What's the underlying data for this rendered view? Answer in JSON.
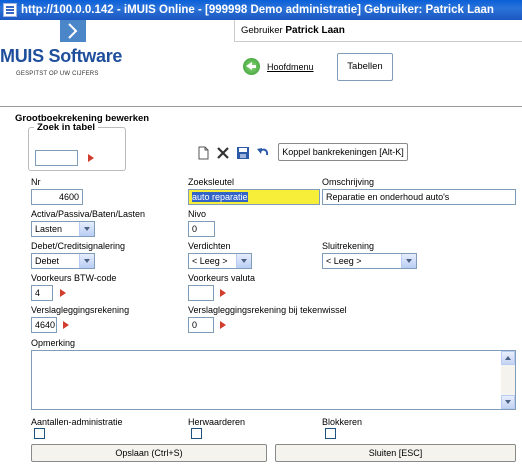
{
  "window": {
    "title": "http://100.0.0.142 - iMUIS Online - [999998 Demo administratie] Gebruiker: Patrick Laan"
  },
  "header": {
    "logo_text": "MUIS Software",
    "logo_tagline": "GESPITST OP UW CIJFERS",
    "user_label": "Gebruiker",
    "user_name": "Patrick Laan",
    "home_label": "Hoofdmenu",
    "tables_label": "Tabellen"
  },
  "form": {
    "title": "Grootboekrekening bewerken",
    "search": {
      "legend": "Zoek in tabel",
      "value": ""
    },
    "toolbar": {
      "icons": [
        "new-document-icon",
        "delete-icon",
        "save-disk-icon",
        "undo-icon"
      ],
      "link_bank_label": "Koppel bankrekeningen [Alt-K]"
    },
    "nr": {
      "label": "Nr",
      "value": "4600"
    },
    "zoeksleutel": {
      "label": "Zoeksleutel",
      "value": "auto reparatie"
    },
    "omschrijving": {
      "label": "Omschrijving",
      "value": "Reparatie en onderhoud auto's"
    },
    "activa": {
      "label": "Activa/Passiva/Baten/Lasten",
      "value": "Lasten"
    },
    "nivo": {
      "label": "Nivo",
      "value": "0"
    },
    "debet_credit": {
      "label": "Debet/Creditsignalering",
      "value": "Debet"
    },
    "verdichten": {
      "label": "Verdichten",
      "value": "< Leeg >"
    },
    "sluitrekening": {
      "label": "Sluitrekening",
      "value": "< Leeg >"
    },
    "btw_code": {
      "label": "Voorkeurs BTW-code",
      "value": "4"
    },
    "valuta": {
      "label": "Voorkeurs valuta",
      "value": ""
    },
    "verslaglegging": {
      "label": "Verslagleggingsrekening",
      "value": "4640"
    },
    "verslaglegging_teken": {
      "label": "Verslagleggingsrekening bij tekenwissel",
      "value": "0"
    },
    "opmerking": {
      "label": "Opmerking",
      "value": ""
    },
    "aantallen": {
      "label": "Aantallen-administratie",
      "checked": false
    },
    "herwaarderen": {
      "label": "Herwaarderen",
      "checked": false
    },
    "blokkeren": {
      "label": "Blokkeren",
      "checked": false
    },
    "save_label": "Opslaan (Ctrl+S)",
    "close_label": "Sluiten [ESC]"
  },
  "colors": {
    "title_bar": "#1c57c2",
    "highlight": "#f7ee3a",
    "logo_blue": "#1f4f9c"
  }
}
